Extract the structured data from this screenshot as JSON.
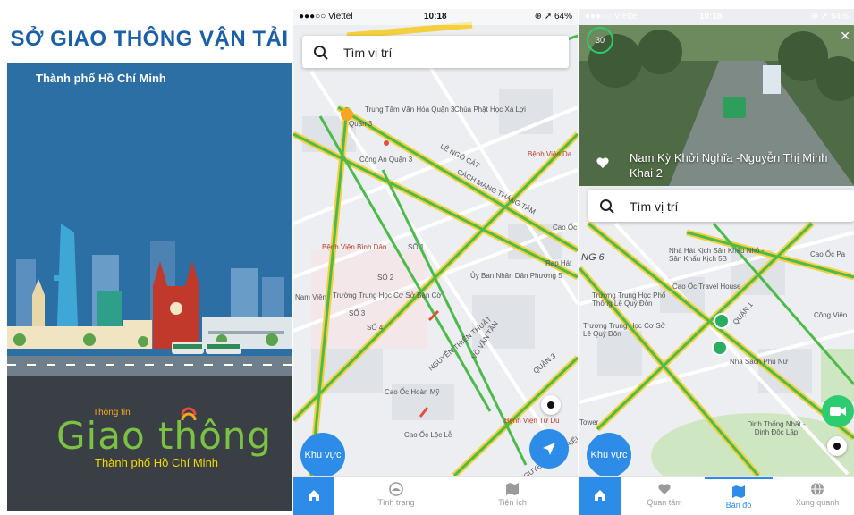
{
  "splash": {
    "title": "SỞ GIAO THÔNG VẬN TẢI",
    "subtitle": "Thành phố Hồ Chí Minh",
    "logo_small": "Thông tin",
    "logo_big": "Giao thông",
    "logo_sub": "Thành phố Hồ Chí Minh"
  },
  "status": {
    "carrier": "●●●○○ Viettel",
    "time": "10:18",
    "battery": "⊕ ➚ 64%"
  },
  "search": {
    "placeholder": "Tìm vị trí"
  },
  "map2": {
    "labels": [
      "Quận 3",
      "Trung Tâm Văn Hóa Quận 3",
      "Chùa Phật Học Xá Lợi",
      "Công An Quận 3",
      "LÊ NGÔ CÁT",
      "Bệnh Viện Da",
      "CÁCH MẠNG THÁNG TÁM",
      "Cao Ốc",
      "Bệnh Viện Bình Dân",
      "Ủy Ban Nhân Dân Phường 5",
      "Rạp Hát",
      "Nam Viên",
      "Trường Trung Học Cơ Sở Bàn Cờ",
      "SỐ 1",
      "SỐ 2",
      "SỐ 3",
      "SỐ 4",
      "NGUYỄN THIỆN THUẬT",
      "VÕ VĂN TẦN",
      "Cao Ốc Hoàn Mỹ",
      "Cao Ốc Lộc Lễ",
      "Bệnh Viện Từ Dũ",
      "QUẬN 3",
      "NGUYỄN ĐÌNH CHIỂU"
    ]
  },
  "map3": {
    "labels": [
      "NG 6",
      "Nhà Hát Kịch Sân Khấu Nhỏ - Sân Khấu Kịch 5B",
      "Cao Ốc Pa",
      "Cao Ốc Travel House",
      "Trường Trung Học Phổ Thông Lê Quý Đôn",
      "Trường Trung Học Cơ Sở Lê Quý Đôn",
      "QUẬN 1",
      "Công Viên",
      "Nhà Sách Phú Nữ",
      "Dinh Thống Nhất - Dinh Độc Lập",
      "Tower"
    ],
    "camera_caption": "Nam Kỳ Khởi Nghĩa -Nguyễn Thị Minh Khai 2",
    "camera_timer": "30"
  },
  "buttons": {
    "khu_vuc": "Khu vực"
  },
  "tabs2": [
    {
      "label": "",
      "icon": "home-icon"
    },
    {
      "label": "Tình trạng",
      "icon": "traffic-status-icon"
    },
    {
      "label": "Tiện ích",
      "icon": "map-utility-icon"
    }
  ],
  "tabs3": [
    {
      "label": "",
      "icon": "home-icon"
    },
    {
      "label": "Quan tâm",
      "icon": "heart-icon"
    },
    {
      "label": "Bản đồ",
      "icon": "map-icon"
    },
    {
      "label": "Xung quanh",
      "icon": "globe-icon"
    }
  ],
  "colors": {
    "accent": "#2d8ce8",
    "road_yellow": "#f4d03f",
    "road_green": "#4cbb4c",
    "splash_blue": "#2b6fa5",
    "splash_dark": "#3a3f45"
  }
}
